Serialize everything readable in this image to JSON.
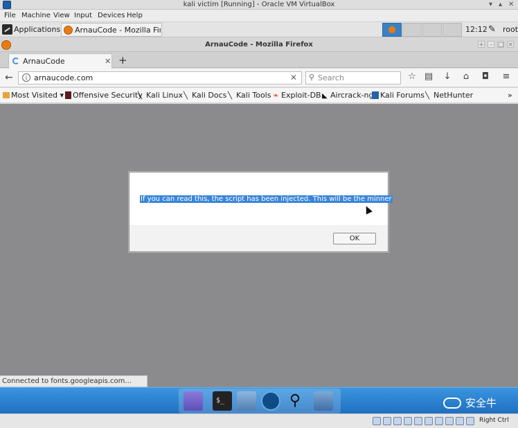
{
  "vbox": {
    "title": "kali victim [Running] - Oracle VM VirtualBox",
    "menu": [
      "File",
      "Machine",
      "View",
      "Input",
      "Devices",
      "Help"
    ],
    "host_key": "Right Ctrl"
  },
  "panel": {
    "applications": "Applications",
    "task_label": "ArnauCode - Mozilla Fire...",
    "clock": "12:12",
    "user": "root"
  },
  "firefox": {
    "window_title": "ArnauCode - Mozilla Firefox",
    "tab_label": "ArnauCode",
    "url": "arnaucode.com",
    "search_placeholder": "Search",
    "bookmarks": [
      "Most Visited",
      "Offensive Security",
      "Kali Linux",
      "Kali Docs",
      "Kali Tools",
      "Exploit-DB",
      "Aircrack-ng",
      "Kali Forums",
      "NetHunter"
    ],
    "status": "Connected to fonts.googleapis.com..."
  },
  "dialog": {
    "message": "If you can read this, the script has been injected. This will be the minner",
    "ok_label": "OK"
  },
  "watermark": "安全牛",
  "icons": {
    "back": "back-arrow-icon",
    "bookmark_star": "star-icon",
    "reader": "clipboard-icon",
    "download": "download-icon",
    "home": "home-icon",
    "pocket": "pocket-icon",
    "menu": "hamburger-icon"
  }
}
